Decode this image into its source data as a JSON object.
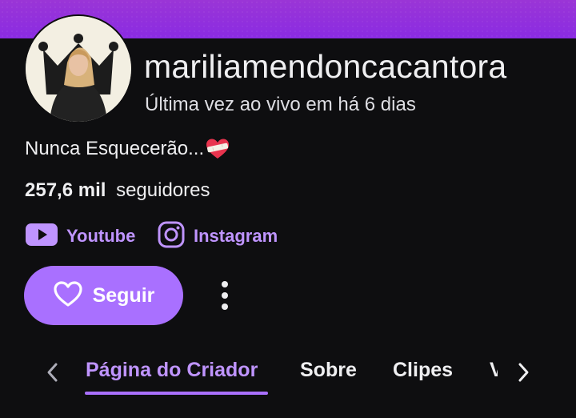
{
  "colors": {
    "accent": "#a970ff",
    "accent_text": "#bf94ff",
    "background": "#0e0e10",
    "banner": "#9a35d6"
  },
  "channel": {
    "name": "mariliamendoncacantora",
    "last_live": "Última vez ao vivo em há 6 dias",
    "bio": "Nunca Esquecerão...",
    "bio_emoji": "heart-with-bandage-icon",
    "followers_count": "257,6 mil",
    "followers_label": "seguidores"
  },
  "social_links": [
    {
      "label": "Youtube",
      "icon": "youtube-icon"
    },
    {
      "label": "Instagram",
      "icon": "instagram-icon"
    }
  ],
  "actions": {
    "follow_label": "Seguir",
    "follow_icon": "heart-outline-icon",
    "more_icon": "more-vertical-icon"
  },
  "tabs": [
    {
      "label": "Página do Criador",
      "active": true
    },
    {
      "label": "Sobre",
      "active": false
    },
    {
      "label": "Clipes",
      "active": false
    },
    {
      "label": "V",
      "active": false
    }
  ]
}
